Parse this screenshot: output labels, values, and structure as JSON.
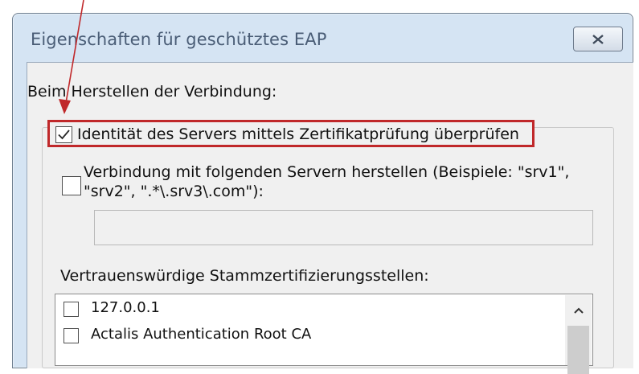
{
  "window": {
    "title": "Eigenschaften für geschütztes EAP"
  },
  "dialog": {
    "connection_label": "Beim Herstellen der Verbindung:",
    "verify_server": {
      "label": "Identität des Servers mittels Zertifikatprüfung überprüfen",
      "checked": true
    },
    "connect_to_servers": {
      "label_line1": "Verbindung mit folgenden Servern herstellen (Beispiele: \"srv1\",",
      "label_line2": "\"srv2\", \".*\\.srv3\\.com\"):",
      "checked": false,
      "value": ""
    },
    "trusted_roots_label": "Vertrauenswürdige Stammzertifizierungsstellen:",
    "trusted_roots": [
      {
        "label": "127.0.0.1",
        "checked": false
      },
      {
        "label": "Actalis Authentication Root CA",
        "checked": false
      }
    ]
  },
  "annotation": {
    "color": "#c0282a"
  }
}
